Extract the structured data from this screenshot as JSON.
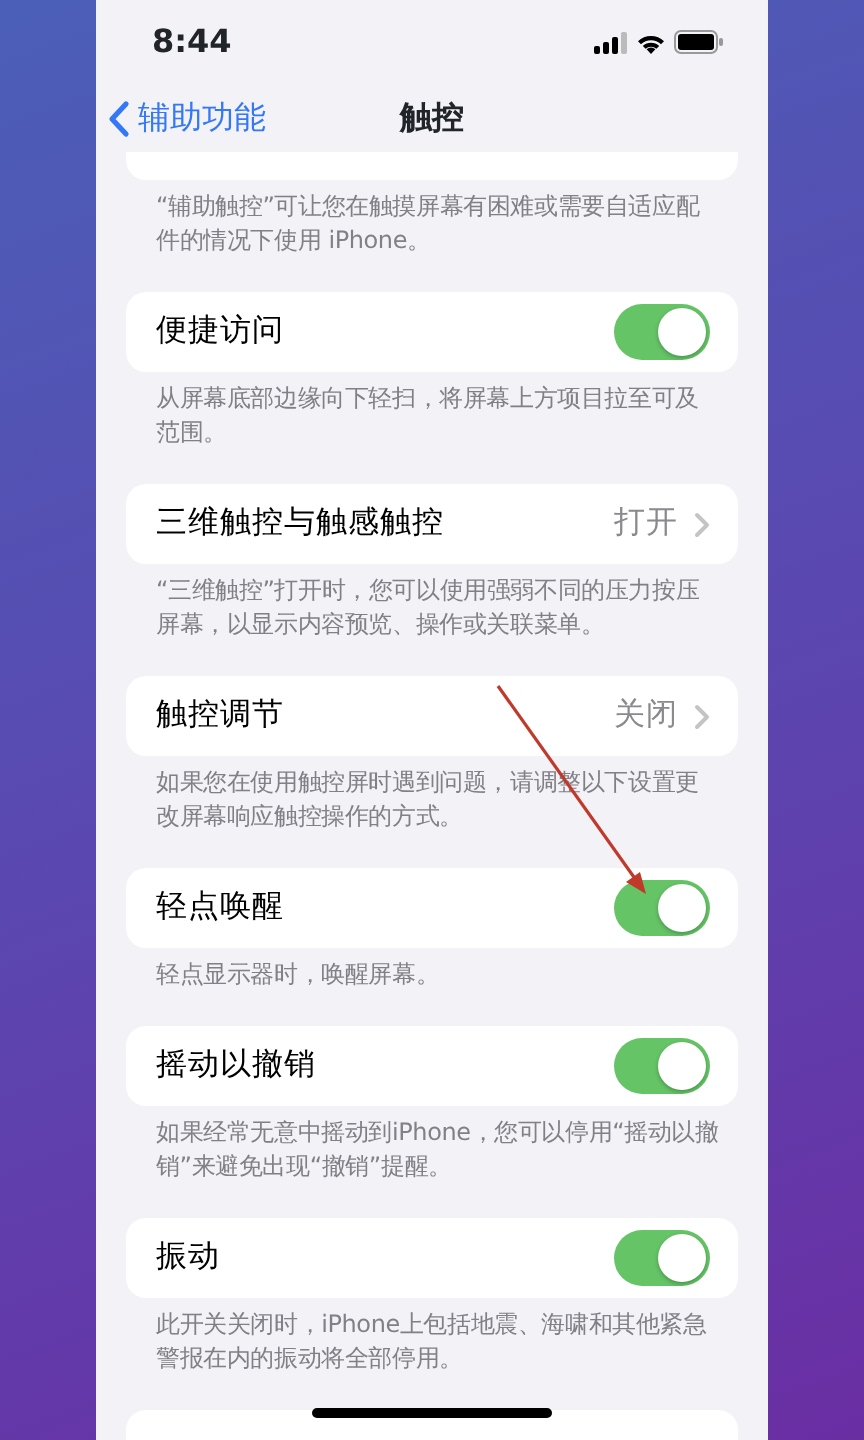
{
  "status_bar": {
    "time": "8:44"
  },
  "nav": {
    "back": "辅助功能",
    "title": "触控"
  },
  "sections": [
    {
      "kind": "partial",
      "footer": "“辅助触控”可让您在触摸屏幕有困难或需要自适应配件的情况下使用 iPhone。"
    },
    {
      "kind": "toggle",
      "label": "便捷访问",
      "on": true,
      "footer": "从屏幕底部边缘向下轻扫，将屏幕上方项目拉至可及范围。"
    },
    {
      "kind": "link",
      "label": "三维触控与触感触控",
      "value": "打开",
      "footer": "“三维触控”打开时，您可以使用强弱不同的压力按压屏幕，以显示内容预览、操作或关联菜单。"
    },
    {
      "kind": "link",
      "label": "触控调节",
      "value": "关闭",
      "footer": "如果您在使用触控屏时遇到问题，请调整以下设置更改屏幕响应触控操作的方式。"
    },
    {
      "kind": "toggle",
      "label": "轻点唤醒",
      "on": true,
      "footer": "轻点显示器时，唤醒屏幕。"
    },
    {
      "kind": "toggle",
      "label": "摇动以撤销",
      "on": true,
      "footer": "如果经常无意中摇动到iPhone，您可以停用“摇动以撤销”来避免出现“撤销”提醒。"
    },
    {
      "kind": "toggle",
      "label": "振动",
      "on": true,
      "footer": "此开关关闭时，iPhone上包括地震、海啸和其他紧急警报在内的振动将全部停用。"
    },
    {
      "kind": "partial"
    }
  ]
}
